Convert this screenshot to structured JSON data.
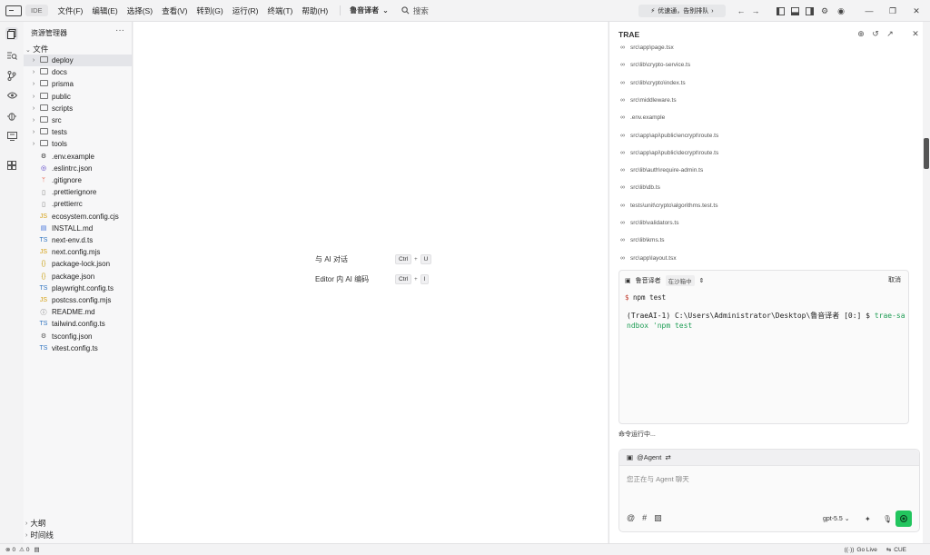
{
  "titlebar": {
    "ide_tag": "IDE",
    "menus": [
      "文件(F)",
      "编辑(E)",
      "选择(S)",
      "查看(V)",
      "转到(G)",
      "运行(R)",
      "终端(T)",
      "帮助(H)"
    ],
    "project_name": "鲁音译者",
    "search_label": "搜索",
    "promo_text": "优速通，告别排队"
  },
  "explorer": {
    "title": "资源管理器",
    "root_label": "文件",
    "items": [
      {
        "name": "deploy",
        "type": "folder"
      },
      {
        "name": "docs",
        "type": "folder"
      },
      {
        "name": "prisma",
        "type": "folder"
      },
      {
        "name": "public",
        "type": "folder"
      },
      {
        "name": "scripts",
        "type": "folder"
      },
      {
        "name": "src",
        "type": "folder"
      },
      {
        "name": "tests",
        "type": "folder"
      },
      {
        "name": "tools",
        "type": "folder"
      },
      {
        "name": ".env.example",
        "type": "gear"
      },
      {
        "name": ".eslintrc.json",
        "type": "eslint"
      },
      {
        "name": ".gitignore",
        "type": "git"
      },
      {
        "name": ".prettierignore",
        "type": "file"
      },
      {
        "name": ".prettierrc",
        "type": "file"
      },
      {
        "name": "ecosystem.config.cjs",
        "type": "js"
      },
      {
        "name": "INSTALL.md",
        "type": "md"
      },
      {
        "name": "next-env.d.ts",
        "type": "ts"
      },
      {
        "name": "next.config.mjs",
        "type": "js"
      },
      {
        "name": "package-lock.json",
        "type": "json"
      },
      {
        "name": "package.json",
        "type": "json"
      },
      {
        "name": "playwright.config.ts",
        "type": "ts"
      },
      {
        "name": "postcss.config.mjs",
        "type": "js"
      },
      {
        "name": "README.md",
        "type": "info"
      },
      {
        "name": "tailwind.config.ts",
        "type": "ts"
      },
      {
        "name": "tsconfig.json",
        "type": "tsconfig"
      },
      {
        "name": "vitest.config.ts",
        "type": "ts"
      }
    ],
    "outline_label": "大纲",
    "timeline_label": "时间线"
  },
  "editor": {
    "shortcuts": [
      {
        "label": "与 AI 对话",
        "mod": "Ctrl",
        "key": "U"
      },
      {
        "label": "Editor 内 AI 编码",
        "mod": "Ctrl",
        "key": "I"
      }
    ]
  },
  "panel": {
    "title": "TRAE",
    "files": [
      "src\\app\\page.tsx",
      "src\\lib\\crypto-service.ts",
      "src\\lib\\crypto\\index.ts",
      "src\\middleware.ts",
      ".env.example",
      "src\\app\\api\\public\\encrypt\\route.ts",
      "src\\app\\api\\public\\decrypt\\route.ts",
      "src\\lib\\auth\\require-admin.ts",
      "src\\lib\\db.ts",
      "tests\\unit\\crypto\\algorithms.test.ts",
      "src\\lib\\validators.ts",
      "src\\lib\\kms.ts",
      "src\\app\\layout.tsx"
    ],
    "terminal": {
      "name": "鲁音译者",
      "badge": "在沙箱中",
      "cancel": "取消",
      "command": "npm test",
      "output_prefix": "(TraeAI-1) C:\\Users\\Administrator\\Desktop\\鲁音译者 [0:] $ ",
      "output_cmd": "trae-sandbox 'npm test"
    },
    "run_status": "命令运行中...",
    "chat": {
      "agent_label": "@Agent",
      "placeholder": "您正在与 Agent 聊天",
      "model": "gpt-5.5"
    }
  },
  "statusbar": {
    "errors": "0",
    "warnings": "0",
    "golive": "Go Live",
    "cue": "CUE"
  }
}
